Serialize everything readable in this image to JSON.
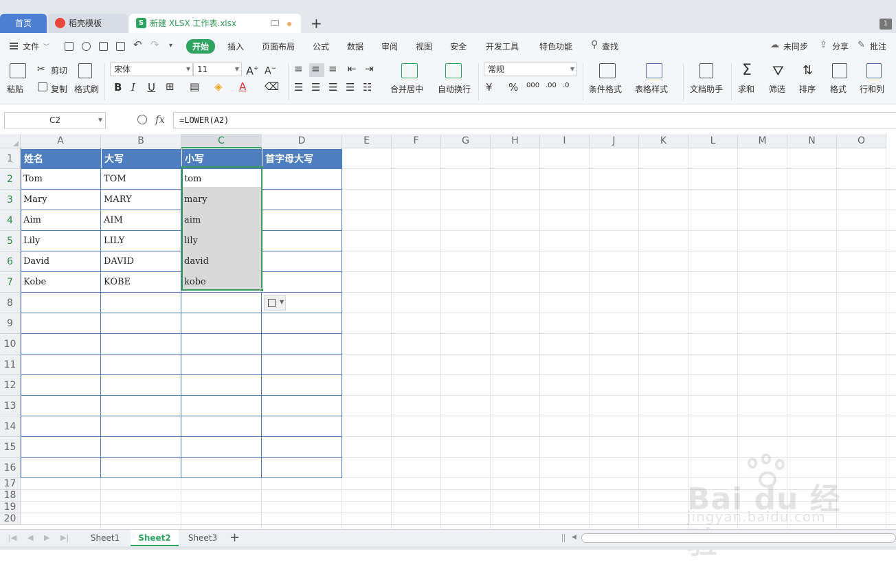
{
  "tabs": {
    "home": "首页",
    "wps_templates": "稻壳模板",
    "file": "新建 XLSX 工作表.xlsx",
    "file_icon_letter": "S",
    "new_tab": "+",
    "window_count": "1"
  },
  "menu": {
    "file": "文件",
    "start": "开始",
    "insert": "插入",
    "page_layout": "页面布局",
    "formula": "公式",
    "data": "数据",
    "review": "审阅",
    "view": "视图",
    "security": "安全",
    "dev_tools": "开发工具",
    "features": "特色功能",
    "find": "查找",
    "sync": "未同步",
    "share": "分享",
    "comment": "批注"
  },
  "ribbon": {
    "paste": "粘贴",
    "cut": "剪切",
    "copy": "复制",
    "format_painter": "格式刷",
    "font_name": "宋体",
    "font_size": "11",
    "merge_center": "合并居中",
    "wrap_text": "自动换行",
    "number_format": "常规",
    "conditional_format": "条件格式",
    "table_style": "表格样式",
    "doc_assistant": "文档助手",
    "sum": "求和",
    "filter": "筛选",
    "sort": "排序",
    "format": "格式",
    "row_col": "行和列"
  },
  "formula_bar": {
    "cell_ref": "C2",
    "fx": "fx",
    "formula": "=LOWER(A2)"
  },
  "columns": [
    "A",
    "B",
    "C",
    "D",
    "E",
    "F",
    "G",
    "H",
    "I",
    "J",
    "K",
    "L",
    "M",
    "N",
    "O"
  ],
  "rows": [
    "1",
    "2",
    "3",
    "4",
    "5",
    "6",
    "7",
    "8",
    "9",
    "10",
    "11",
    "12",
    "13",
    "14",
    "15",
    "16",
    "17",
    "18",
    "19",
    "20"
  ],
  "table": {
    "headers": [
      "姓名",
      "大写",
      "小写",
      "首字母大写"
    ],
    "rows": [
      [
        "Tom",
        "TOM",
        "tom",
        ""
      ],
      [
        "Mary",
        "MARY",
        "mary",
        ""
      ],
      [
        "Aim",
        "AIM",
        "aim",
        ""
      ],
      [
        "Lily",
        "LILY",
        "lily",
        ""
      ],
      [
        "David",
        "DAVID",
        "david",
        ""
      ],
      [
        "Kobe",
        "KOBE",
        "kobe",
        ""
      ]
    ]
  },
  "sheets": [
    "Sheet1",
    "Sheet2",
    "Sheet3"
  ],
  "active_sheet": "Sheet2",
  "watermark": {
    "brand": "Bai du 经验",
    "url": "jingyan.baidu.com"
  },
  "colors": {
    "accent": "#2fa460",
    "header_fill": "#4d7fc0",
    "home_tab": "#4a7fd4"
  }
}
